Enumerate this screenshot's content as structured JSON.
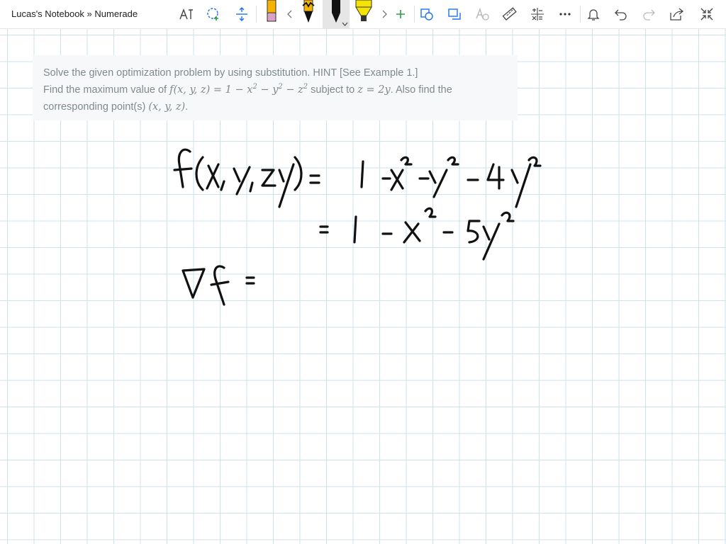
{
  "window": {
    "title": "Lucas's Notebook » Numerade"
  },
  "toolbar": {
    "tools": [
      {
        "name": "lasso-text-tool",
        "icon": "text-lasso-icon"
      },
      {
        "name": "lasso-select-tool",
        "icon": "lasso-plus-icon"
      },
      {
        "name": "insert-space-tool",
        "icon": "insert-space-icon"
      }
    ],
    "pens": [
      {
        "name": "pink-pen",
        "color": "#d9a2c7"
      },
      {
        "name": "black-pencil",
        "color": "#111111"
      },
      {
        "name": "black-pen",
        "color": "#111111"
      },
      {
        "name": "yellow-highlighter",
        "color": "#f5e400"
      }
    ],
    "accent": "#1a73e8"
  },
  "problem": {
    "line1": "Solve the given optimization problem by using substitution. HINT [See Example 1.]",
    "line2_prefix": "Find the maximum value of ",
    "function_lhs": "f(x, y, z)",
    "function_rhs_a": " = 1 − x",
    "function_rhs_b": " − y",
    "function_rhs_c": " − z",
    "exp": "2",
    "subject_to": " subject to ",
    "constraint": "z = 2y",
    "line2_suffix": ". Also find the",
    "line3_prefix": "corresponding point(s) ",
    "point": "(x, y, z)",
    "line3_suffix": "."
  }
}
